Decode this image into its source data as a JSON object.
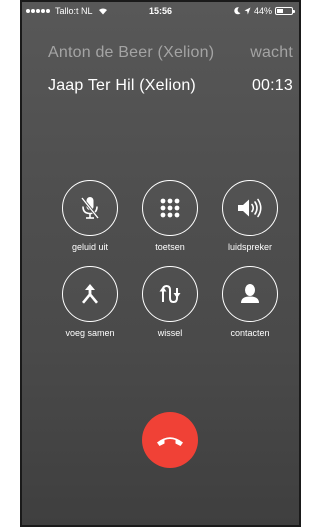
{
  "status_bar": {
    "carrier": "Tallo:t NL",
    "time": "15:56",
    "battery_text": "44%",
    "battery_level_percent": 44
  },
  "calls": [
    {
      "name": "Anton de Beer (Xelion)",
      "status": "wacht",
      "state": "held"
    },
    {
      "name": "Jaap Ter Hil (Xelion)",
      "status": "00:13",
      "state": "active"
    }
  ],
  "controls": [
    {
      "label": "geluid uit",
      "icon": "mic-off-icon"
    },
    {
      "label": "toetsen",
      "icon": "keypad-icon"
    },
    {
      "label": "luidspreker",
      "icon": "speaker-icon"
    },
    {
      "label": "voeg samen",
      "icon": "merge-icon"
    },
    {
      "label": "wissel",
      "icon": "swap-icon"
    },
    {
      "label": "contacten",
      "icon": "contact-icon"
    }
  ],
  "end_call": {
    "icon": "hangup-icon",
    "color": "#f04136"
  }
}
